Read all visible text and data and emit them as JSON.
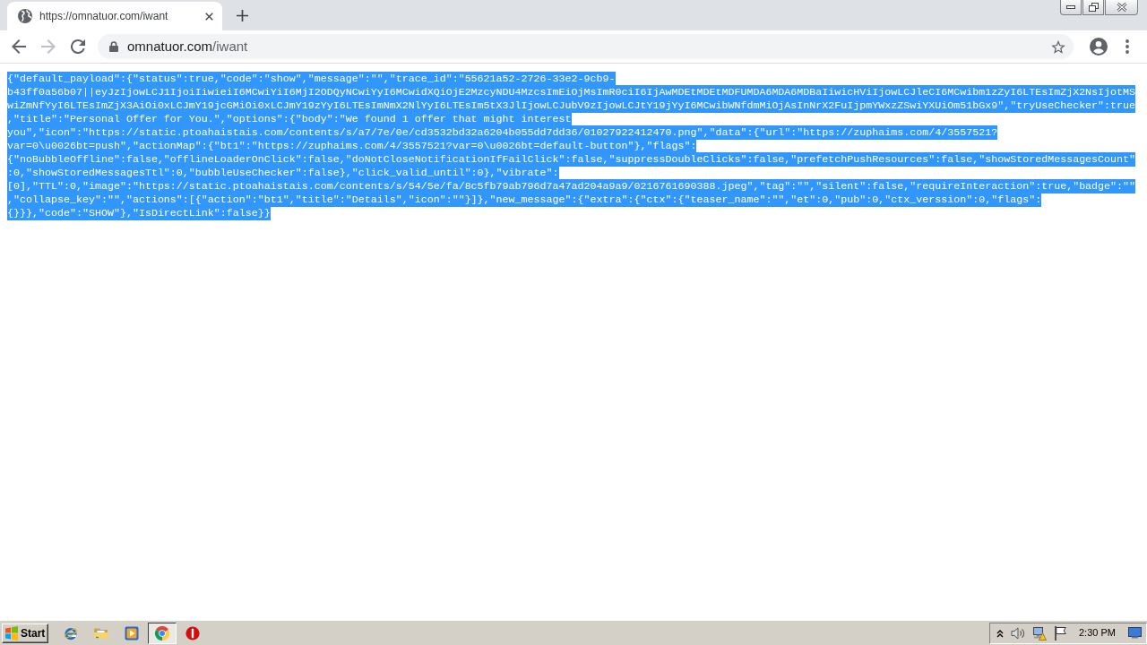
{
  "browser": {
    "tabs": [
      {
        "title": "https://omnatuor.com/iwant",
        "selected": true
      }
    ],
    "nav_buttons": [
      {
        "kind": "back",
        "disabled": false
      },
      {
        "kind": "forward",
        "disabled": true
      },
      {
        "kind": "reload",
        "disabled": false
      }
    ],
    "address_bar": {
      "host": "omnatuor.com",
      "path": "/iwant"
    }
  },
  "page": {
    "selected": true,
    "lines": [
      "{\"default_payload\":{\"status\":true,\"code\":\"show\",\"message\":\"\",\"trace_id\":\"55621a52-2726-33e2-9cb9-",
      "b43ff0a56b07||eyJzIjowLCJ1IjoiIiwieiI6MCwiYiI6MjI2ODQyNCwiYyI6MCwidXQiOjE2MzcyNDU4MzcsImEiOjMsImR0ciI6IjAwMDEtMDEtMDFUMDA6MDA6MDBaIiwicHViIjowLCJleCI6MCwibm1zZyI6LTEsImZjX2NsIjotMS",
      "wiZmNfYyI6LTEsImZjX3AiOi0xLCJmY19jcGMiOi0xLCJmY19zYyI6LTEsImNmX2NlYyI6LTEsIm5tX3JlIjowLCJubV9zIjowLCJtY19jYyI6MCwibWNfdmMiOjAsInNrX2FuIjpmYWxzZSwiYXUiOm51bGx9\",\"tryUseChecker\":true",
      ",\"title\":\"Personal Offer for You.\",\"options\":{\"body\":\"We found 1 offer that might interest",
      "you\",\"icon\":\"https://static.ptoahaistais.com/contents/s/a7/7e/0e/cd3532bd32a6204b055dd7dd36/01027922412470.png\",\"data\":{\"url\":\"https://zuphaims.com/4/3557521?",
      "var=0\\u0026bt=push\",\"actionMap\":{\"bt1\":\"https://zuphaims.com/4/3557521?var=0\\u0026bt=default-button\"},\"flags\":",
      "{\"noBubbleOffline\":false,\"offlineLoaderOnClick\":false,\"doNotCloseNotificationIfFailClick\":false,\"suppressDoubleClicks\":false,\"prefetchPushResources\":false,\"showStoredMessagesCount\"",
      ":0,\"showStoredMessagesTtl\":0,\"bubbleUseChecker\":false},\"click_valid_until\":0},\"vibrate\":",
      "[0],\"TTL\":0,\"image\":\"https://static.ptoahaistais.com/contents/s/54/5e/fa/8c5fb79ab796d7a47ad204a9a9/0216761690388.jpeg\",\"tag\":\"\",\"silent\":false,\"requireInteraction\":true,\"badge\":\"\"",
      ",\"collapse_key\":\"\",\"actions\":[{\"action\":\"bt1\",\"title\":\"Details\",\"icon\":\"\"}]},\"new_message\":{\"extra\":{\"ctx\":{\"teaser_name\":\"\",\"et\":0,\"pub\":0,\"ctx_verssion\":0,\"flags\":",
      "{}}},\"code\":\"SHOW\"},\"IsDirectLink\":false}}"
    ]
  },
  "taskbar": {
    "start_label": "Start",
    "apps": [
      {
        "kind": "ie",
        "selected": false
      },
      {
        "kind": "folder",
        "selected": false
      },
      {
        "kind": "media",
        "selected": false
      },
      {
        "kind": "chrome",
        "selected": true
      },
      {
        "kind": "alert",
        "selected": false
      }
    ],
    "tray_icons": [
      {
        "kind": "chevron"
      },
      {
        "kind": "speaker"
      },
      {
        "kind": "network"
      },
      {
        "kind": "flag"
      }
    ],
    "clock": "2:30 PM"
  }
}
